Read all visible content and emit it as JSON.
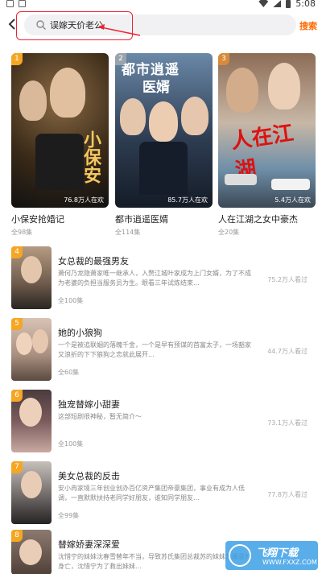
{
  "status_bar": {
    "time": "5:08"
  },
  "search": {
    "query": "误嫁天价老公",
    "button_label": "搜索"
  },
  "top_cards": [
    {
      "rank": "1",
      "title": "小保安抢婚记",
      "episodes": "全98集",
      "views": "76.8万人在欢",
      "cover_text": "小保安",
      "badge_color": "#f5a623"
    },
    {
      "rank": "2",
      "title": "都市逍遥医婿",
      "episodes": "全114集",
      "views": "85.7万人在欢",
      "cover_text": "都市逍遥医婿",
      "badge_color": "#9aa3ad"
    },
    {
      "rank": "3",
      "title": "人在江湖之女中豪杰",
      "episodes": "全20集",
      "views": "5.4万人在欢",
      "cover_text": "人在江湖",
      "badge_color": "#d8893a"
    }
  ],
  "list": [
    {
      "rank": "4",
      "title": "女总裁的最强男友",
      "desc": "萧何乃龙隐萧家唯一继承人，入赘江城叶家成为上门女婿，为了不成为老婆的负担当服务员为生。眼看三年试炼结束...",
      "episodes": "全100集",
      "views": "75.2万人看过"
    },
    {
      "rank": "5",
      "title": "她的小狼狗",
      "desc": "一个是被追联姻的落魄千金，一个是早有预谋的首富太子，一场豁家又浪折的下下狼狗之恋就此展开...",
      "episodes": "全60集",
      "views": "44.7万人看过"
    },
    {
      "rank": "6",
      "title": "独宠替嫁小甜妻",
      "desc": "这部短剧很神秘，暂无简介～",
      "episodes": "全100集",
      "views": "73.1万人看过"
    },
    {
      "rank": "7",
      "title": "美女总裁的反击",
      "desc": "安小冉家境三年创业创办百亿资产集团帝豪集团，事业有成为人低调，一直默默扶持老同学好朋友，谁知同学朋友...",
      "episodes": "全99集",
      "views": "77.8万人看过"
    },
    {
      "rank": "8",
      "title": "替嫁娇妻深深爱",
      "desc": "沈惜宁的妹妹沈春雪替年不当，导致苏氏集团总裁苏的妹妹苏阑意外身亡，沈惜宁为了救出妹妹...",
      "episodes": "",
      "views": ""
    }
  ],
  "watermark": {
    "main": "飞翔下载",
    "sub": "WWW.FXXZ.COM"
  }
}
